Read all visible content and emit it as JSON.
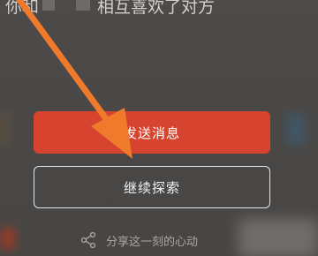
{
  "match": {
    "text_start": "你和",
    "text_end": "相互喜欢了对方"
  },
  "buttons": {
    "send_message": "发送消息",
    "continue_explore": "继续探索"
  },
  "share": {
    "label": "分享这一刻的心动",
    "icon": "share-icon"
  },
  "annotation": {
    "arrow_color": "#f07a2c"
  },
  "colors": {
    "send_button": "#d6432f",
    "background": "#4a4846"
  }
}
